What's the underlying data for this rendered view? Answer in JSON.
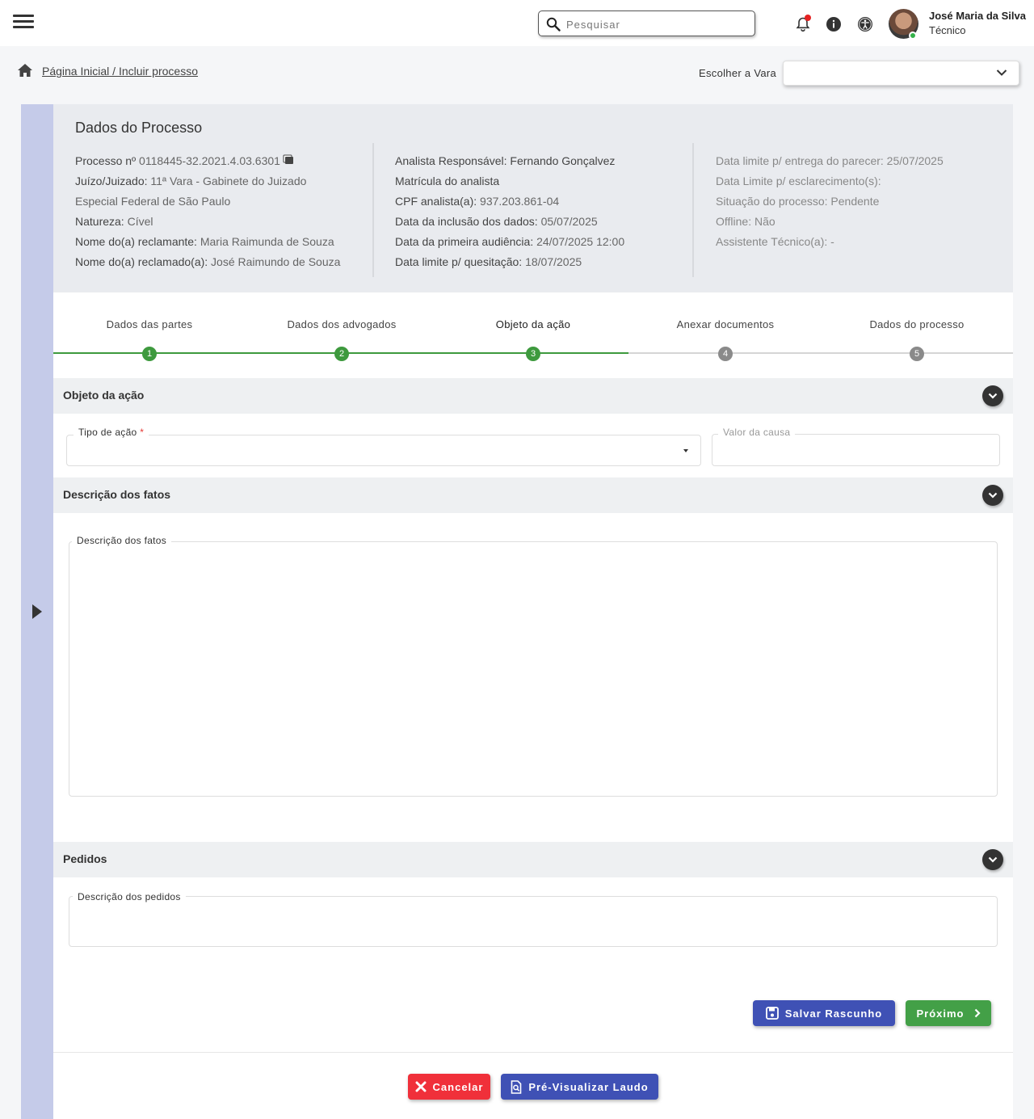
{
  "header": {
    "search_placeholder": "Pesquisar",
    "user_name": "José Maria da Silva",
    "user_role": "Técnico"
  },
  "breadcrumb": {
    "text": "Página Inicial / Incluir processo"
  },
  "vara": {
    "label": "Escolher a Vara",
    "value": ""
  },
  "process": {
    "title": "Dados do Processo",
    "col1": [
      {
        "label": "Processo nº",
        "value": " 0118445-32.2021.4.03.6301"
      },
      {
        "label": "Juízo/Juizado:",
        "value": " 11ª Vara - Gabinete do Juizado"
      },
      {
        "label": "",
        "value": "Especial Federal de São Paulo"
      },
      {
        "label": "Natureza:",
        "value": " Cível"
      },
      {
        "label": "Nome do(a) reclamante:",
        "value": " Maria Raimunda de Souza"
      },
      {
        "label": "Nome do(a) reclamado(a):",
        "value": " José Raimundo de Souza"
      }
    ],
    "col2": [
      {
        "label": "Analista Responsável:",
        "value": " Fernando Gonçalvez"
      },
      {
        "label": "Matrícula do analista",
        "value": ""
      },
      {
        "label": "CPF analista(a):",
        "value": " 937.203.861-04"
      },
      {
        "label": "Data da inclusão dos dados:",
        "value": " 05/07/2025"
      },
      {
        "label": "Data da primeira audiência:",
        "value": " 24/07/2025  12:00"
      },
      {
        "label": "Data limite p/ quesitação:",
        "value": " 18/07/2025"
      }
    ],
    "col3": [
      {
        "label": "Data limite p/ entrega do parecer:",
        "value": " 25/07/2025"
      },
      {
        "label": "Data Limite p/ esclarecimento(s):",
        "value": ""
      },
      {
        "label": "Situação do processo:",
        "value": " Pendente"
      },
      {
        "label": "Offline:",
        "value": " Não"
      },
      {
        "label": "Assistente Técnico(a):",
        "value": " -"
      }
    ]
  },
  "stepper": {
    "current_step": 3,
    "steps": [
      {
        "label": "Dados das partes",
        "number": "1"
      },
      {
        "label": "Dados dos advogados",
        "number": "2"
      },
      {
        "label": "Objeto da ação",
        "number": "3"
      },
      {
        "label": "Anexar documentos",
        "number": "4"
      },
      {
        "label": "Dados do processo",
        "number": "5"
      }
    ]
  },
  "sections": {
    "objeto": {
      "title": "Objeto da ação",
      "tipo_label": "Tipo de ação",
      "required_mark": "*",
      "tipo_value": "",
      "valor_label": "Valor da causa",
      "valor_value": ""
    },
    "descricao": {
      "title": "Descrição dos fatos",
      "field_label": "Descrição dos fatos",
      "value": ""
    },
    "pedidos": {
      "title": "Pedidos",
      "field_label": "Descrição dos pedidos",
      "value": ""
    }
  },
  "actions": {
    "save_draft": "Salvar Rascunho",
    "next": "Próximo",
    "cancel": "Cancelar",
    "preview": "Pré-Visualizar Laudo"
  },
  "colors": {
    "primary": "#3f51b5",
    "success": "#43a047",
    "danger": "#f0303a",
    "step_done": "#3e9a3e",
    "step_todo": "#8a8a8a",
    "rail": "#c5cbe9"
  },
  "icons": {
    "menu": "hamburger-icon",
    "search": "search-icon",
    "bell": "bell-icon",
    "info": "info-icon",
    "accessibility": "accessibility-icon",
    "home": "home-icon",
    "expand": "chevron-down-icon",
    "save": "floppy-icon",
    "next": "chevron-right-icon",
    "cancel": "close-icon",
    "preview": "document-search-icon"
  }
}
